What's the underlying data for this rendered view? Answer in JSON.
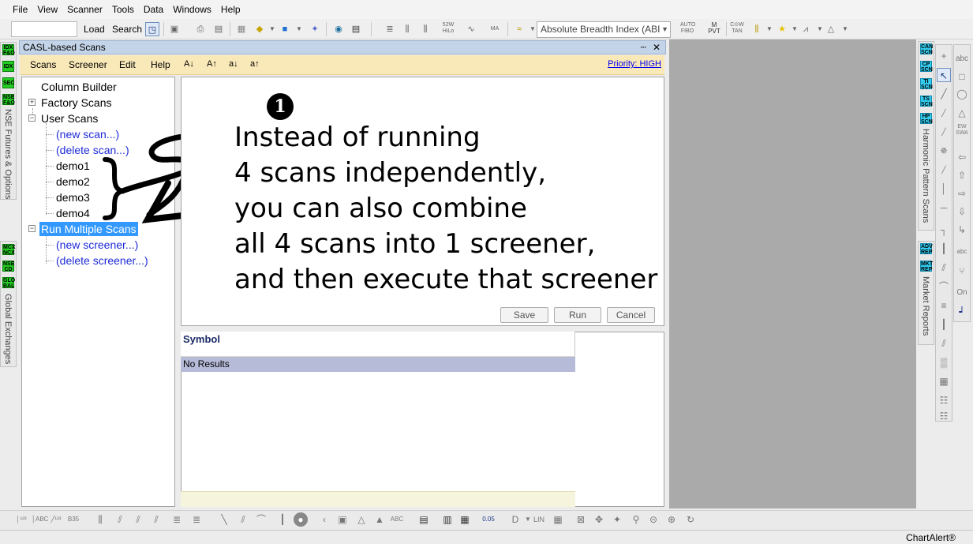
{
  "menubar": [
    "File",
    "View",
    "Scanner",
    "Tools",
    "Data",
    "Windows",
    "Help"
  ],
  "toolbar": {
    "load": "Load",
    "search": "Search",
    "indicator_select": "Absolute Breadth Index (ABI"
  },
  "panel": {
    "title": "CASL-based Scans",
    "pin": "ⵈ",
    "close": "✕",
    "menu": [
      "Scans",
      "Screener",
      "Edit",
      "Help"
    ],
    "font_buttons": [
      "A↓",
      "A↑",
      "a↓",
      "a↑"
    ],
    "priority": "Priority: HIGH"
  },
  "tree": {
    "column_builder": "Column Builder",
    "factory_scans": "Factory Scans",
    "user_scans": "User Scans",
    "new_scan": "(new scan...)",
    "delete_scan": "(delete scan...)",
    "demos": [
      "demo1",
      "demo2",
      "demo3",
      "demo4"
    ],
    "run_multiple": "Run Multiple Scans",
    "new_screener": "(new screener...)",
    "delete_screener": "(delete screener...)"
  },
  "editor": {
    "bullet": "1",
    "lines": [
      "Instead of running",
      "4 scans independently,",
      "you can also combine",
      "all 4 scans into 1 screener,",
      "and then execute that screener"
    ],
    "buttons": {
      "save": "Save",
      "run": "Run",
      "cancel": "Cancel"
    }
  },
  "results": {
    "column": "Symbol",
    "empty": "No Results"
  },
  "left_dock": {
    "top_tabs": [
      "IDX\nF&O",
      "IDX",
      "SEC",
      "NSE\nF&O"
    ],
    "top_label": "NSE Futures & Options",
    "bottom_tabs": [
      "MCX\nNCX",
      "NSE\nCD",
      "GLO\nBAL"
    ],
    "bottom_label": "Global Exchanges"
  },
  "right_dock": {
    "top_tabs": [
      "CAN\nSCN",
      "CP\nSCN",
      "TI\nSCN",
      "TS\nSCN",
      "HP\nSCN"
    ],
    "top_label": "Harmonic Pattern Scans",
    "bottom_tabs": [
      "ADV\nREP",
      "MKT\nREP"
    ],
    "bottom_label": "Market Reports"
  },
  "status": "ChartAlert®"
}
